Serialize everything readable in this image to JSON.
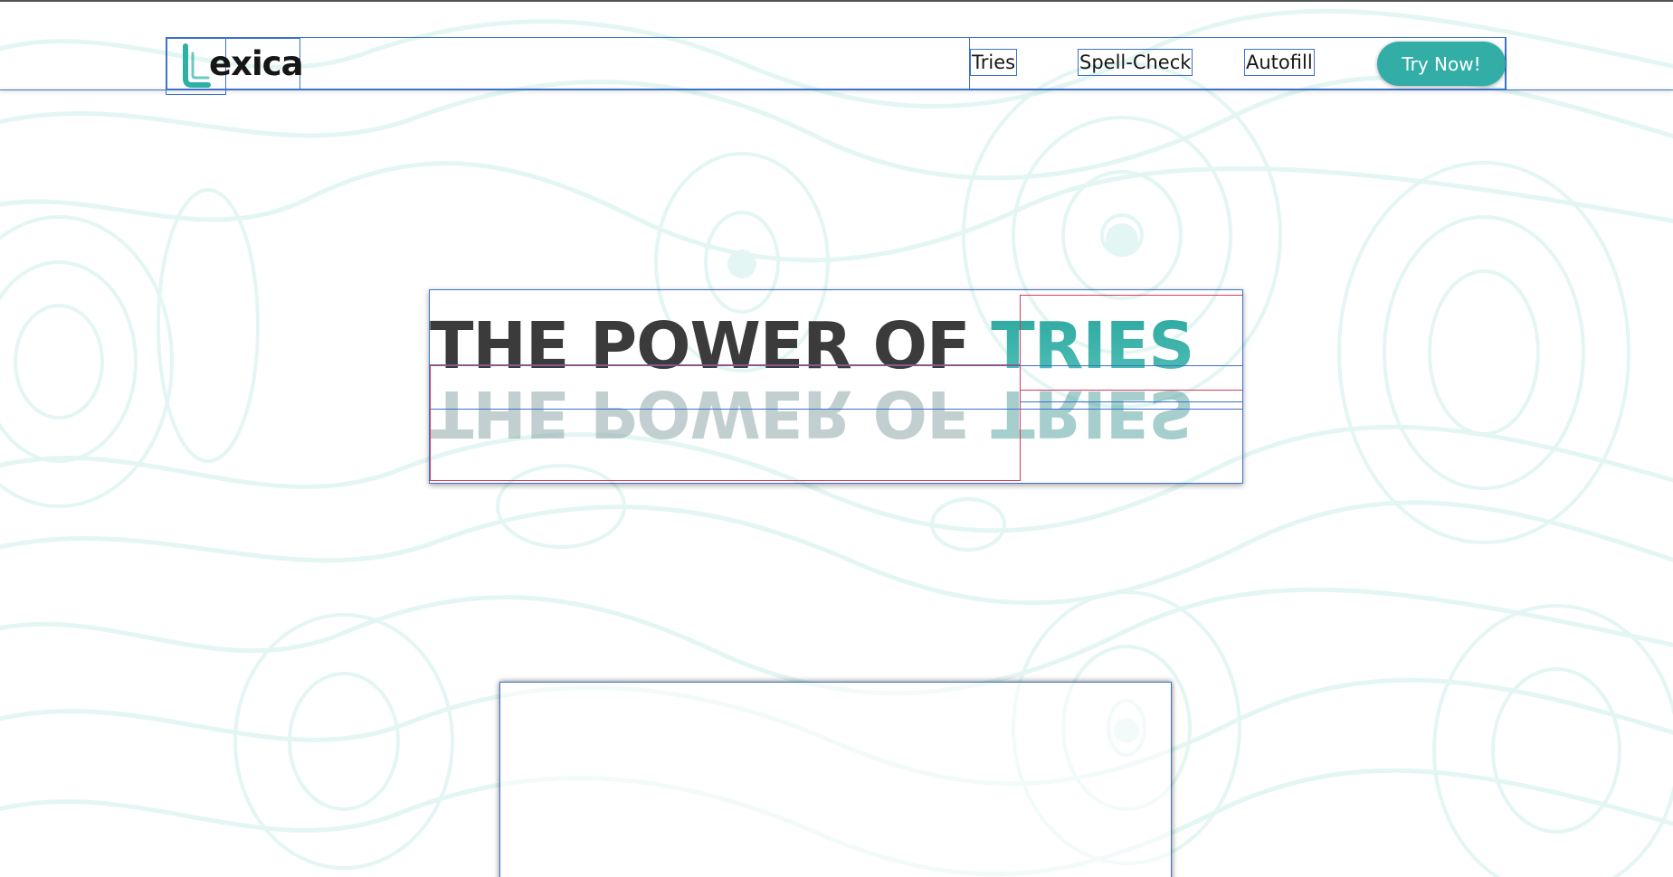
{
  "brand": {
    "name": "exica",
    "logo_letter_icon": "letter-L-logo-icon",
    "accent_color": "#33aea6"
  },
  "nav": {
    "links": [
      {
        "label": "Tries"
      },
      {
        "label": "Spell-Check"
      },
      {
        "label": "Autofill"
      }
    ],
    "cta_label": "Try Now!"
  },
  "hero": {
    "title_prefix": "THE POWER OF",
    "title_highlight": "TRIES",
    "text_color": "#3b3b3b",
    "highlight_color": "#2fb0a7",
    "reflection": true
  },
  "background": {
    "pattern": "topographic-contour-lines",
    "line_color": "#e6f7f5"
  }
}
